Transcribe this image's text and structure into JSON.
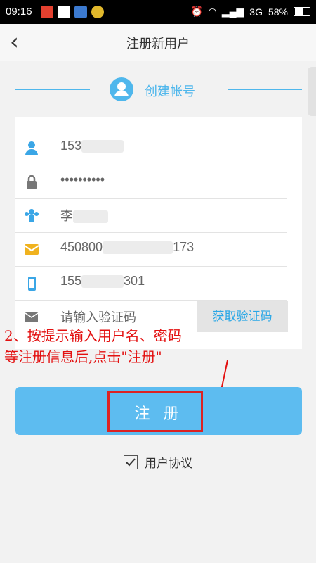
{
  "status_bar": {
    "time": "09:16",
    "network": "3G",
    "battery": "58%"
  },
  "header": {
    "back_label": "‹",
    "title": "注册新用户"
  },
  "section": {
    "title": "创建帐号",
    "accent": "#4fb7ec"
  },
  "form": {
    "phone_value": "153",
    "password_value": "••••••••••",
    "name_value": "李",
    "id_prefix": "450800",
    "id_suffix": "173",
    "mobile_prefix": "155",
    "mobile_suffix": "301",
    "code_placeholder": "请输入验证码",
    "get_code_label": "获取验证码"
  },
  "annotation": {
    "line1": "2、按提示输入用户名、密码",
    "line2": "等注册信息后,点击\"注册\"",
    "color": "#e31010"
  },
  "register": {
    "label": "注 册",
    "color": "#5dbcf0"
  },
  "agreement": {
    "label": "用户协议",
    "checked": true
  }
}
